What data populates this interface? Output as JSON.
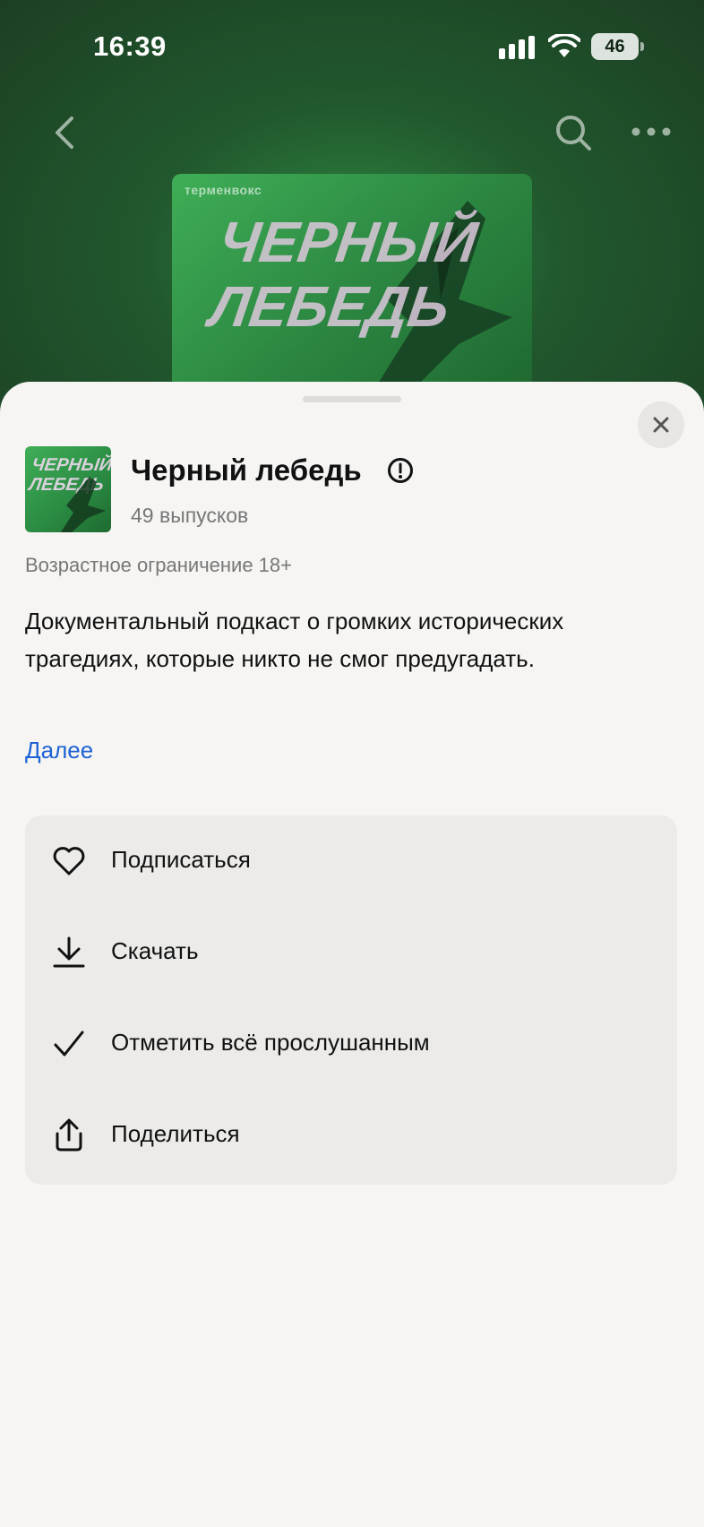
{
  "status_bar": {
    "time": "16:39",
    "battery": "46"
  },
  "cover": {
    "brand": "терменвокс",
    "title_line1": "ЧЕРНЫЙ",
    "title_line2": "ЛЕБЕДЬ"
  },
  "podcast": {
    "title": "Черный лебедь",
    "episodes": "49 выпусков",
    "age_restriction": "Возрастное ограничение 18+",
    "description": "Документальный подкаст о громких исторических трагедиях, которые никто не смог предугадать.",
    "more_link": "Далее"
  },
  "menu": {
    "items": [
      {
        "label": "Подписаться",
        "icon": "heart-icon"
      },
      {
        "label": "Скачать",
        "icon": "download-icon"
      },
      {
        "label": "Отметить всё прослушанным",
        "icon": "check-icon"
      },
      {
        "label": "Поделиться",
        "icon": "share-icon"
      }
    ]
  },
  "colors": {
    "header_green": "#21582d",
    "cover_green": "#3fae57",
    "link_blue": "#1d62d4",
    "sheet_bg": "#f6f5f3",
    "menu_bg": "#ecebe9"
  }
}
